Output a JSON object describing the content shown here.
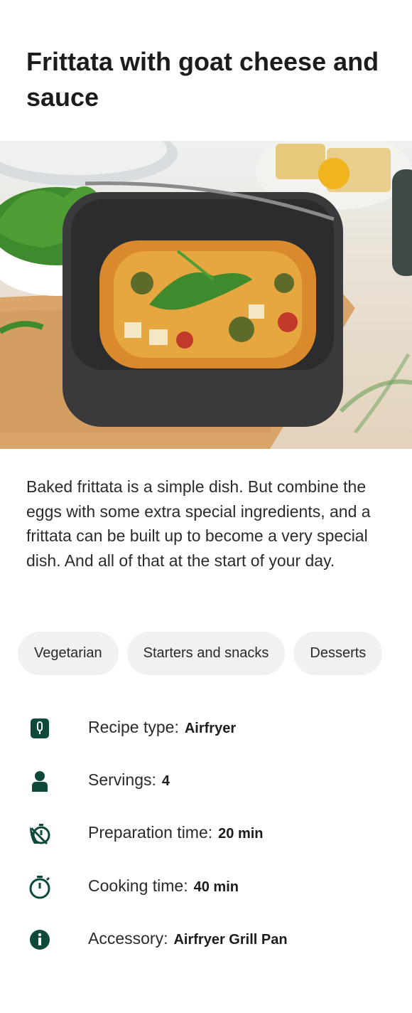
{
  "recipe": {
    "title": "Frittata with goat cheese and sauce",
    "description": "Baked frittata is a simple dish. But combine the eggs with some extra special ingredients, and a frittata can be built up to become a very special dish. And all of that at the start of your day."
  },
  "hero_image": {
    "icon": "frittata-photo",
    "subject": "Frittata in airfryer baking pan with arugula"
  },
  "tags": [
    "Vegetarian",
    "Starters and snacks",
    "Desserts"
  ],
  "details": [
    {
      "icon": "airfryer-icon",
      "label": "Recipe type:",
      "value": "Airfryer"
    },
    {
      "icon": "person-icon",
      "label": "Servings:",
      "value": "4"
    },
    {
      "icon": "prep-timer-icon",
      "label": "Preparation time:",
      "value": "20 min"
    },
    {
      "icon": "stopwatch-icon",
      "label": "Cooking time:",
      "value": "40 min"
    },
    {
      "icon": "info-icon",
      "label": "Accessory:",
      "value": "Airfryer Grill Pan"
    }
  ],
  "colors": {
    "icon": "#0d4a3c",
    "chip_bg": "#f1f1f1",
    "text": "#2a2a2a"
  }
}
